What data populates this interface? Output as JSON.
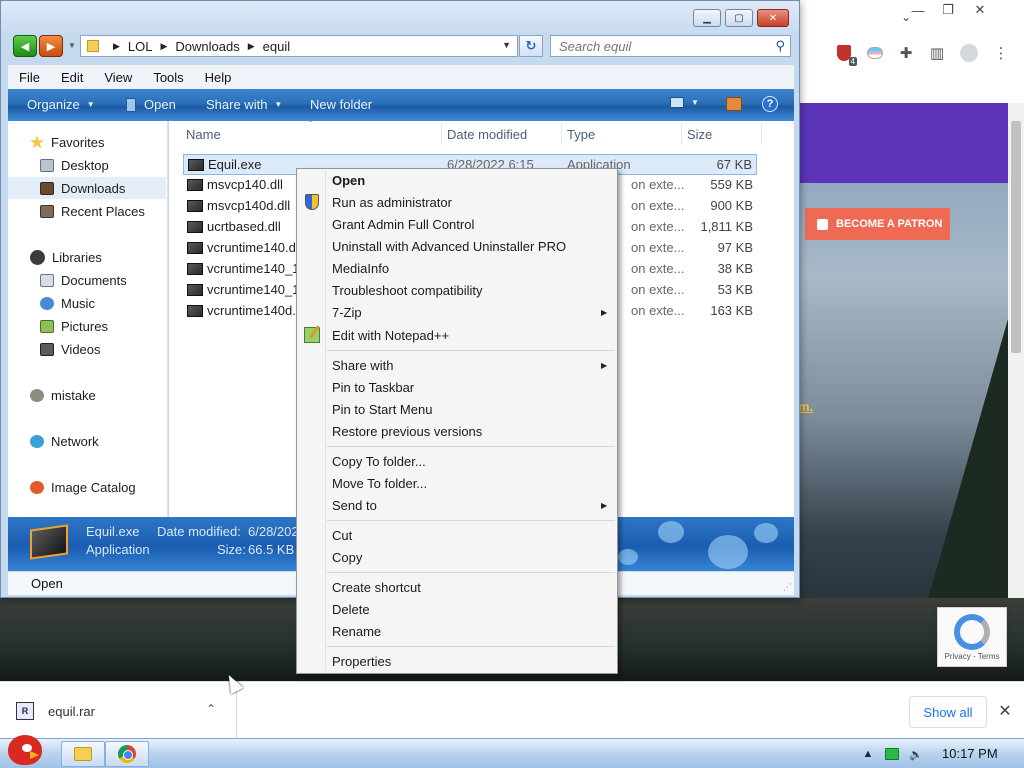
{
  "explorer": {
    "address": {
      "crumbs": [
        "LOL",
        "Downloads",
        "equil"
      ]
    },
    "search": {
      "placeholder": "Search equil"
    },
    "menu": [
      "File",
      "Edit",
      "View",
      "Tools",
      "Help"
    ],
    "commands": {
      "organize": "Organize",
      "open": "Open",
      "share_with": "Share with",
      "new_folder": "New folder"
    },
    "nav": {
      "favorites": "Favorites",
      "desktop": "Desktop",
      "downloads": "Downloads",
      "recent": "Recent Places",
      "libraries": "Libraries",
      "documents": "Documents",
      "music": "Music",
      "pictures": "Pictures",
      "videos": "Videos",
      "mistake": "mistake",
      "network": "Network",
      "image_catalog": "Image Catalog"
    },
    "columns": {
      "name": "Name",
      "date": "Date modified",
      "type": "Type",
      "size": "Size"
    },
    "files": [
      {
        "name": "Equil.exe",
        "date": "6/28/2022 6:15",
        "type": "Application",
        "size": "67 KB"
      },
      {
        "name": "msvcp140.dll",
        "date": "",
        "type": "on exte...",
        "size": "559 KB"
      },
      {
        "name": "msvcp140d.dll",
        "date": "",
        "type": "on exte...",
        "size": "900 KB"
      },
      {
        "name": "ucrtbased.dll",
        "date": "",
        "type": "on exte...",
        "size": "1,811 KB"
      },
      {
        "name": "vcruntime140.dll",
        "date": "",
        "type": "on exte...",
        "size": "97 KB"
      },
      {
        "name": "vcruntime140_1",
        "date": "",
        "type": "on exte...",
        "size": "38 KB"
      },
      {
        "name": "vcruntime140_1",
        "date": "",
        "type": "on exte...",
        "size": "53 KB"
      },
      {
        "name": "vcruntime140d.",
        "date": "",
        "type": "on exte...",
        "size": "163 KB"
      }
    ],
    "details": {
      "name": "Equil.exe",
      "type": "Application",
      "modified_label": "Date modified:",
      "modified_value": "6/28/202",
      "size_label": "Size:",
      "size_value": "66.5 KB"
    },
    "status": "Open"
  },
  "context_menu": {
    "open": "Open",
    "run_admin": "Run as administrator",
    "grant_admin": "Grant Admin Full Control",
    "uninstall": "Uninstall with Advanced Uninstaller PRO",
    "mediainfo": "MediaInfo",
    "troubleshoot": "Troubleshoot compatibility",
    "seven_zip": "7-Zip",
    "notepad": "Edit with Notepad++",
    "share_with": "Share with",
    "pin_taskbar": "Pin to Taskbar",
    "pin_start": "Pin to Start Menu",
    "restore": "Restore previous versions",
    "copy_to": "Copy To folder...",
    "move_to": "Move To folder...",
    "send_to": "Send to",
    "cut": "Cut",
    "copy": "Copy",
    "create_shortcut": "Create shortcut",
    "delete": "Delete",
    "rename": "Rename",
    "properties": "Properties"
  },
  "browser": {
    "patron_button": "BECOME A PATRON",
    "site_link": "m.",
    "recaptcha_text": "Privacy - Terms",
    "extension_badge": "4"
  },
  "downloads_bar": {
    "file": "equil.rar",
    "show_all": "Show all"
  },
  "taskbar": {
    "clock": "10:17 PM"
  },
  "colors": {
    "command_bar": "#2b6fb9",
    "site_header": "#5b34b8",
    "patron_button": "#ee6a55",
    "show_all_text": "#1a73e8"
  }
}
